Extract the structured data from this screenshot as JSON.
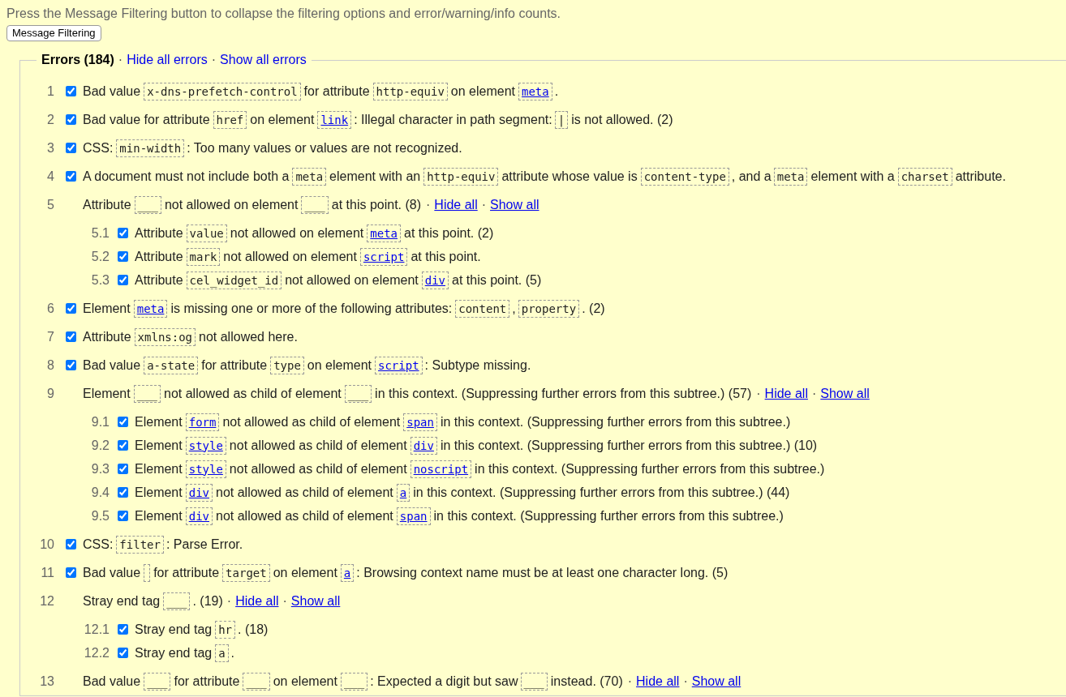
{
  "intro": "Press the Message Filtering button to collapse the filtering options and error/warning/info counts.",
  "filter_button": "Message Filtering",
  "errors": {
    "title": "Errors (184)",
    "separator": "·",
    "links": [
      "Hide all errors",
      "Show all errors"
    ],
    "messages": [
      {
        "kind": "item",
        "number": "1",
        "checked": true,
        "parts": [
          {
            "kind": "text",
            "text": "Bad value"
          },
          {
            "kind": "code",
            "text": "x-dns-prefetch-control"
          },
          {
            "kind": "text",
            "text": "for attribute"
          },
          {
            "kind": "code",
            "text": "http-equiv"
          },
          {
            "kind": "text",
            "text": "on element"
          },
          {
            "kind": "element",
            "text": "meta"
          },
          {
            "kind": "text",
            "text": "."
          }
        ]
      },
      {
        "kind": "item",
        "number": "2",
        "checked": true,
        "parts": [
          {
            "kind": "text",
            "text": "Bad value for attribute"
          },
          {
            "kind": "code",
            "text": "href"
          },
          {
            "kind": "text",
            "text": "on element"
          },
          {
            "kind": "element",
            "text": "link"
          },
          {
            "kind": "text",
            "text": ": Illegal character in path segment:"
          },
          {
            "kind": "code",
            "text": "|"
          },
          {
            "kind": "text",
            "text": "is not allowed. (2)"
          }
        ]
      },
      {
        "kind": "item",
        "number": "3",
        "checked": true,
        "parts": [
          {
            "kind": "text",
            "text": "CSS:"
          },
          {
            "kind": "code",
            "text": "min-width"
          },
          {
            "kind": "text",
            "text": ": Too many values or values are not recognized."
          }
        ]
      },
      {
        "kind": "item",
        "number": "4",
        "checked": true,
        "parts": [
          {
            "kind": "text",
            "text": "A document must not include both a"
          },
          {
            "kind": "code",
            "text": "meta"
          },
          {
            "kind": "text",
            "text": "element with an"
          },
          {
            "kind": "code",
            "text": "http-equiv"
          },
          {
            "kind": "text",
            "text": "attribute whose value is"
          },
          {
            "kind": "code",
            "text": "content-type"
          },
          {
            "kind": "text",
            "text": ", and a"
          },
          {
            "kind": "code",
            "text": "meta"
          },
          {
            "kind": "text",
            "text": "element with a"
          },
          {
            "kind": "code",
            "text": "charset"
          },
          {
            "kind": "text",
            "text": "attribute."
          }
        ]
      },
      {
        "kind": "group",
        "number": "5",
        "parts": [
          {
            "kind": "text",
            "text": "Attribute"
          },
          {
            "kind": "code",
            "text": "___"
          },
          {
            "kind": "text",
            "text": "not allowed on element"
          },
          {
            "kind": "code",
            "text": "___"
          },
          {
            "kind": "text",
            "text": "at this point. (8)"
          }
        ],
        "separator": "·",
        "links": [
          "Hide all",
          "Show all"
        ],
        "children": [
          {
            "number": "5.1",
            "checked": true,
            "parts": [
              {
                "kind": "text",
                "text": "Attribute"
              },
              {
                "kind": "code",
                "text": "value"
              },
              {
                "kind": "text",
                "text": "not allowed on element"
              },
              {
                "kind": "element",
                "text": "meta"
              },
              {
                "kind": "text",
                "text": "at this point. (2)"
              }
            ]
          },
          {
            "number": "5.2",
            "checked": true,
            "parts": [
              {
                "kind": "text",
                "text": "Attribute"
              },
              {
                "kind": "code",
                "text": "mark"
              },
              {
                "kind": "text",
                "text": "not allowed on element"
              },
              {
                "kind": "element",
                "text": "script"
              },
              {
                "kind": "text",
                "text": "at this point."
              }
            ]
          },
          {
            "number": "5.3",
            "checked": true,
            "parts": [
              {
                "kind": "text",
                "text": "Attribute"
              },
              {
                "kind": "code",
                "text": "cel_widget_id"
              },
              {
                "kind": "text",
                "text": "not allowed on element"
              },
              {
                "kind": "element",
                "text": "div"
              },
              {
                "kind": "text",
                "text": "at this point. (5)"
              }
            ]
          }
        ]
      },
      {
        "kind": "item",
        "number": "6",
        "checked": true,
        "parts": [
          {
            "kind": "text",
            "text": "Element"
          },
          {
            "kind": "element",
            "text": "meta"
          },
          {
            "kind": "text",
            "text": "is missing one or more of the following attributes:"
          },
          {
            "kind": "code",
            "text": "content"
          },
          {
            "kind": "text",
            "text": ","
          },
          {
            "kind": "code",
            "text": "property"
          },
          {
            "kind": "text",
            "text": ". (2)"
          }
        ]
      },
      {
        "kind": "item",
        "number": "7",
        "checked": true,
        "parts": [
          {
            "kind": "text",
            "text": "Attribute"
          },
          {
            "kind": "code",
            "text": "xmlns:og"
          },
          {
            "kind": "text",
            "text": "not allowed here."
          }
        ]
      },
      {
        "kind": "item",
        "number": "8",
        "checked": true,
        "parts": [
          {
            "kind": "text",
            "text": "Bad value"
          },
          {
            "kind": "code",
            "text": "a-state"
          },
          {
            "kind": "text",
            "text": "for attribute"
          },
          {
            "kind": "code",
            "text": "type"
          },
          {
            "kind": "text",
            "text": "on element"
          },
          {
            "kind": "element",
            "text": "script"
          },
          {
            "kind": "text",
            "text": ": Subtype missing."
          }
        ]
      },
      {
        "kind": "group",
        "number": "9",
        "parts": [
          {
            "kind": "text",
            "text": "Element"
          },
          {
            "kind": "code",
            "text": "___"
          },
          {
            "kind": "text",
            "text": "not allowed as child of element"
          },
          {
            "kind": "code",
            "text": "___"
          },
          {
            "kind": "text",
            "text": "in this context. (Suppressing further errors from this subtree.) (57)"
          }
        ],
        "separator": "·",
        "links": [
          "Hide all",
          "Show all"
        ],
        "children": [
          {
            "number": "9.1",
            "checked": true,
            "parts": [
              {
                "kind": "text",
                "text": "Element"
              },
              {
                "kind": "element",
                "text": "form"
              },
              {
                "kind": "text",
                "text": "not allowed as child of element"
              },
              {
                "kind": "element",
                "text": "span"
              },
              {
                "kind": "text",
                "text": "in this context. (Suppressing further errors from this subtree.)"
              }
            ]
          },
          {
            "number": "9.2",
            "checked": true,
            "parts": [
              {
                "kind": "text",
                "text": "Element"
              },
              {
                "kind": "element",
                "text": "style"
              },
              {
                "kind": "text",
                "text": "not allowed as child of element"
              },
              {
                "kind": "element",
                "text": "div"
              },
              {
                "kind": "text",
                "text": "in this context. (Suppressing further errors from this subtree.) (10)"
              }
            ]
          },
          {
            "number": "9.3",
            "checked": true,
            "parts": [
              {
                "kind": "text",
                "text": "Element"
              },
              {
                "kind": "element",
                "text": "style"
              },
              {
                "kind": "text",
                "text": "not allowed as child of element"
              },
              {
                "kind": "element",
                "text": "noscript"
              },
              {
                "kind": "text",
                "text": "in this context. (Suppressing further errors from this subtree.)"
              }
            ]
          },
          {
            "number": "9.4",
            "checked": true,
            "parts": [
              {
                "kind": "text",
                "text": "Element"
              },
              {
                "kind": "element",
                "text": "div"
              },
              {
                "kind": "text",
                "text": "not allowed as child of element"
              },
              {
                "kind": "element",
                "text": "a"
              },
              {
                "kind": "text",
                "text": "in this context. (Suppressing further errors from this subtree.) (44)"
              }
            ]
          },
          {
            "number": "9.5",
            "checked": true,
            "parts": [
              {
                "kind": "text",
                "text": "Element"
              },
              {
                "kind": "element",
                "text": "div"
              },
              {
                "kind": "text",
                "text": "not allowed as child of element"
              },
              {
                "kind": "element",
                "text": "span"
              },
              {
                "kind": "text",
                "text": "in this context. (Suppressing further errors from this subtree.)"
              }
            ]
          }
        ]
      },
      {
        "kind": "item",
        "number": "10",
        "checked": true,
        "parts": [
          {
            "kind": "text",
            "text": "CSS:"
          },
          {
            "kind": "code",
            "text": "filter"
          },
          {
            "kind": "text",
            "text": ": Parse Error."
          }
        ]
      },
      {
        "kind": "item",
        "number": "11",
        "checked": true,
        "parts": [
          {
            "kind": "text",
            "text": "Bad value"
          },
          {
            "kind": "blank"
          },
          {
            "kind": "text",
            "text": "for attribute"
          },
          {
            "kind": "code",
            "text": "target"
          },
          {
            "kind": "text",
            "text": "on element"
          },
          {
            "kind": "element",
            "text": "a"
          },
          {
            "kind": "text",
            "text": ": Browsing context name must be at least one character long. (5)"
          }
        ]
      },
      {
        "kind": "group",
        "number": "12",
        "parts": [
          {
            "kind": "text",
            "text": "Stray end tag"
          },
          {
            "kind": "code",
            "text": "___"
          },
          {
            "kind": "text",
            "text": ". (19)"
          }
        ],
        "separator": "·",
        "links": [
          "Hide all",
          "Show all"
        ],
        "children": [
          {
            "number": "12.1",
            "checked": true,
            "parts": [
              {
                "kind": "text",
                "text": "Stray end tag"
              },
              {
                "kind": "code",
                "text": "hr"
              },
              {
                "kind": "text",
                "text": ". (18)"
              }
            ]
          },
          {
            "number": "12.2",
            "checked": true,
            "parts": [
              {
                "kind": "text",
                "text": "Stray end tag"
              },
              {
                "kind": "code",
                "text": "a"
              },
              {
                "kind": "text",
                "text": "."
              }
            ]
          }
        ]
      },
      {
        "kind": "group",
        "number": "13",
        "parts": [
          {
            "kind": "text",
            "text": "Bad value"
          },
          {
            "kind": "code",
            "text": "___"
          },
          {
            "kind": "text",
            "text": "for attribute"
          },
          {
            "kind": "code",
            "text": "___"
          },
          {
            "kind": "text",
            "text": "on element"
          },
          {
            "kind": "code",
            "text": "___"
          },
          {
            "kind": "text",
            "text": ": Expected a digit but saw"
          },
          {
            "kind": "code",
            "text": "___"
          },
          {
            "kind": "text",
            "text": "instead. (70)"
          }
        ],
        "separator": "·",
        "links": [
          "Hide all",
          "Show all"
        ]
      }
    ]
  }
}
